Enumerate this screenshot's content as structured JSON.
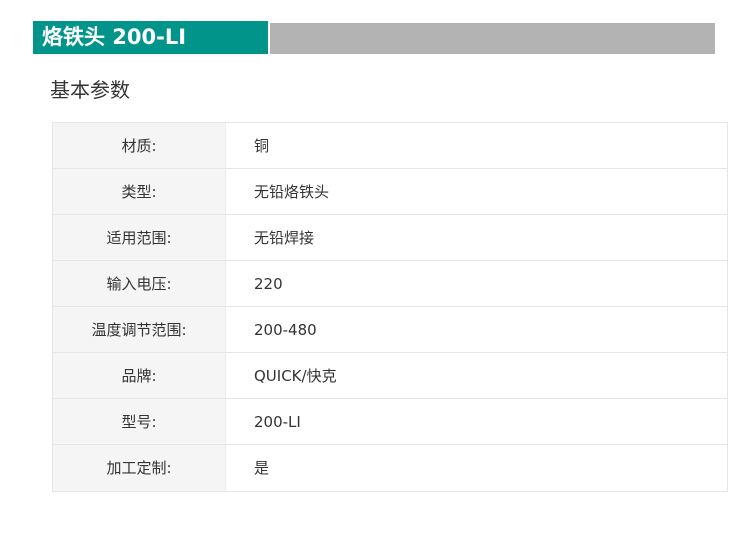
{
  "header": {
    "title": "烙铁头 200-LI"
  },
  "section": {
    "title": "基本参数"
  },
  "specs": [
    {
      "label": "材质:",
      "value": "铜"
    },
    {
      "label": "类型:",
      "value": "无铅烙铁头"
    },
    {
      "label": "适用范围:",
      "value": "无铅焊接"
    },
    {
      "label": "输入电压:",
      "value": "220"
    },
    {
      "label": "温度调节范围:",
      "value": "200-480"
    },
    {
      "label": "品牌:",
      "value": "QUICK/快克"
    },
    {
      "label": "型号:",
      "value": "200-LI"
    },
    {
      "label": "加工定制:",
      "value": "是"
    }
  ],
  "colors": {
    "accent": "#00948a",
    "header_bar_gray": "#b3b3b3",
    "label_bg": "#f5f5f5",
    "border": "#e6e6e6"
  }
}
